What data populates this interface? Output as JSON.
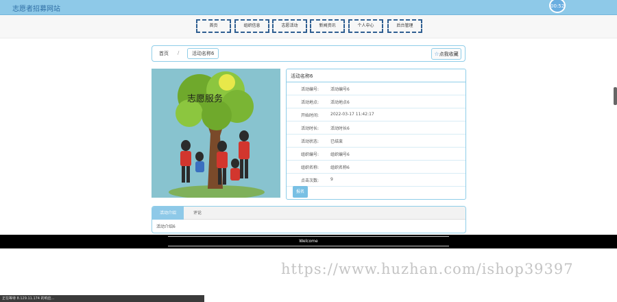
{
  "header": {
    "site_title": "志愿者招募网站",
    "clock": "00:52"
  },
  "nav": {
    "items": [
      "首页",
      "组织信息",
      "志愿活动",
      "新闻资讯",
      "个人中心",
      "后台管理"
    ]
  },
  "breadcrumb": {
    "home": "首页",
    "separator": "/",
    "current": "活动名称6",
    "favorite": "点我收藏"
  },
  "image": {
    "banner_text": "志愿服务"
  },
  "detail": {
    "title": "活动名称6",
    "rows": [
      {
        "label": "活动编号:",
        "value": "活动编号6"
      },
      {
        "label": "活动地点:",
        "value": "活动地点6"
      },
      {
        "label": "开始时间:",
        "value": "2022-03-17 11:42:17"
      },
      {
        "label": "活动时长:",
        "value": "活动时长6"
      },
      {
        "label": "活动状态:",
        "value": "已结束"
      },
      {
        "label": "组织编号:",
        "value": "组织编号6"
      },
      {
        "label": "组织名称:",
        "value": "组织名称6"
      },
      {
        "label": "点击次数:",
        "value": "9"
      }
    ],
    "signup": "报名"
  },
  "tabs": {
    "items": [
      "活动介绍",
      "评论"
    ],
    "content": "活动介绍6"
  },
  "footer": {
    "text": "Welcome"
  },
  "watermark": "https://www.huzhan.com/ishop39397",
  "statusbar": "正在等待 8.129.11.174 的响应...",
  "colors": {
    "primary": "#8ec9e8",
    "nav_border": "#2e5e91",
    "footer": "#000000"
  }
}
